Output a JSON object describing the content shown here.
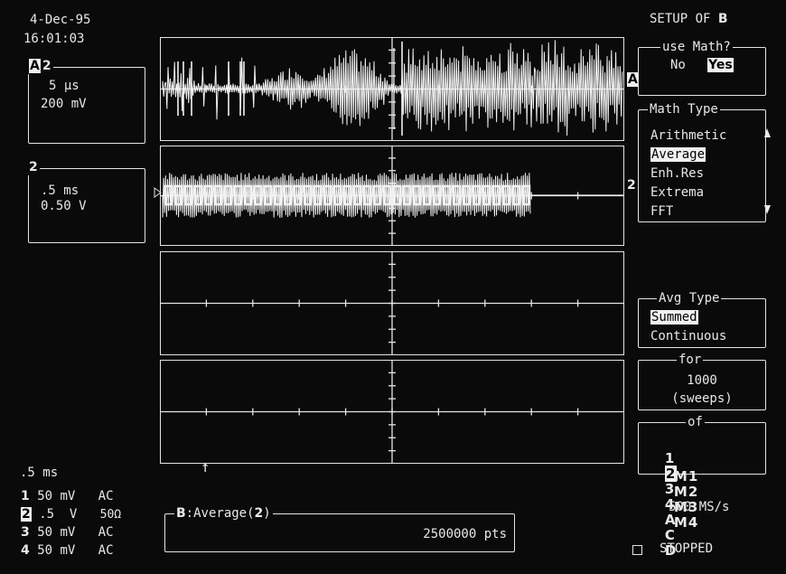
{
  "header": {
    "date": "4-Dec-95",
    "time": "16:01:03",
    "title_prefix": "SETUP OF ",
    "title_trace": "B"
  },
  "trace_a_box": {
    "label_trace": "A",
    "label_channel": "2",
    "timebase": "5 μs",
    "volts": "200 mV"
  },
  "trace_2_box": {
    "label": "2",
    "timebase": ".5 ms",
    "volts": "0.50 V"
  },
  "markers": {
    "trace_a": "A",
    "trace_2": "2"
  },
  "menu": {
    "use_math": {
      "title": "use Math?",
      "no": "No",
      "yes": "Yes",
      "selected": "Yes"
    },
    "math_type": {
      "title": "Math Type",
      "options": [
        "Arithmetic",
        "Average",
        "Enh.Res",
        "Extrema",
        "FFT"
      ],
      "selected": "Average"
    },
    "avg_type": {
      "title": "Avg Type",
      "options": [
        "Summed",
        "Continuous"
      ],
      "selected": "Summed"
    },
    "for": {
      "title": "for",
      "value": "1000",
      "unit": "(sweeps)"
    },
    "of": {
      "title": "of",
      "row1": [
        "1",
        "2",
        "3",
        "4",
        "A",
        "C",
        "D"
      ],
      "row2": [
        "M1",
        "M2",
        "M3",
        "M4"
      ],
      "selected": "2"
    }
  },
  "timebase_readout": ".5 ms",
  "channels": [
    {
      "num": "1",
      "volts": "50 mV",
      "coupling": "AC"
    },
    {
      "num": "2",
      "volts": ".5  V",
      "coupling": "50Ω"
    },
    {
      "num": "3",
      "volts": "50 mV",
      "coupling": "AC"
    },
    {
      "num": "4",
      "volts": "50 mV",
      "coupling": "AC"
    }
  ],
  "math_readout": {
    "trace": "B",
    "func": ":Average(",
    "source": "2",
    "close": ")",
    "points": "2500000 pts"
  },
  "sample_rate": "500 MS/s",
  "status": "STOPPED",
  "trigger_arrow": "↑"
}
